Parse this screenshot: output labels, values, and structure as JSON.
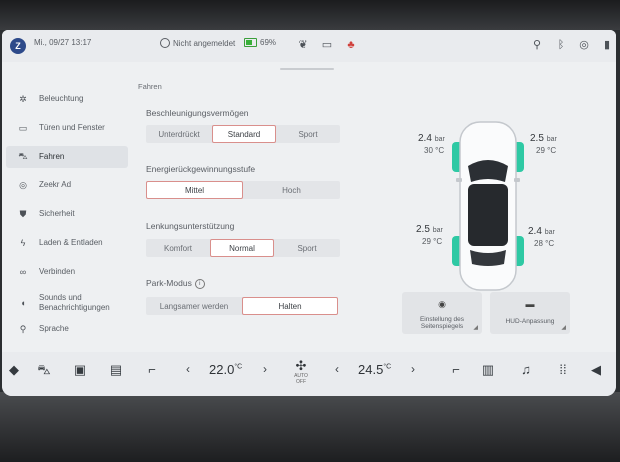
{
  "status": {
    "datetime": "Mi., 09/27 13:17",
    "user": "Nicht angemeldet",
    "battery": "69%",
    "battery_level": 0.69
  },
  "sidebar": {
    "items": [
      {
        "label": "Beleuchtung",
        "icon": "sun-icon"
      },
      {
        "label": "Türen und Fenster",
        "icon": "door-icon"
      },
      {
        "label": "Fahren",
        "icon": "car-icon"
      },
      {
        "label": "Zeekr Ad",
        "icon": "steering-wheel-icon"
      },
      {
        "label": "Sicherheit",
        "icon": "shield-icon"
      },
      {
        "label": "Laden & Entladen",
        "icon": "lightning-icon"
      },
      {
        "label": "Verbinden",
        "icon": "link-icon"
      },
      {
        "label": "Sounds und",
        "label2": "Benachrichtigungen",
        "icon": "speaker-icon"
      },
      {
        "label": "Sprache",
        "icon": "microphone-icon"
      }
    ]
  },
  "main": {
    "section_title": "Fahren",
    "acceleration": {
      "label": "Beschleunigungsvermögen",
      "options": [
        "Unterdrückt",
        "Standard",
        "Sport"
      ],
      "selected": "Standard"
    },
    "regen": {
      "label": "Energierückgewinnungsstufe",
      "options": [
        "Mittel",
        "Hoch"
      ],
      "selected": "Mittel"
    },
    "steering": {
      "label": "Lenkungsunterstützung",
      "options": [
        "Komfort",
        "Normal",
        "Sport"
      ],
      "selected": "Normal"
    },
    "park": {
      "label": "Park-Modus",
      "info_glyph": "i",
      "options": [
        "Langsamer werden",
        "Halten"
      ],
      "selected": "Halten"
    }
  },
  "tires": {
    "front_left": {
      "pressure": "2.4",
      "unit": "bar",
      "temp": "30 °C"
    },
    "front_right": {
      "pressure": "2.5",
      "unit": "bar",
      "temp": "29 °C"
    },
    "rear_left": {
      "pressure": "2.5",
      "unit": "bar",
      "temp": "29 °C"
    },
    "rear_right": {
      "pressure": "2.4",
      "unit": "bar",
      "temp": "28 °C"
    }
  },
  "cards": {
    "mirror": {
      "line1": "Einstellung des",
      "line2": "Seitenspiegels"
    },
    "hud": {
      "label": "HUD-Anpassung"
    }
  },
  "dock": {
    "left_temp": "22.0",
    "right_temp": "24.5",
    "temp_unit": "°C",
    "fan_label": "AUTO",
    "fan_sub": "OFF",
    "prev": "‹",
    "next": "›"
  },
  "colors": {
    "accent_selected_border": "#d98f8c",
    "tire_highlight": "#2ec9a4",
    "battery_green": "#3ab03a"
  }
}
